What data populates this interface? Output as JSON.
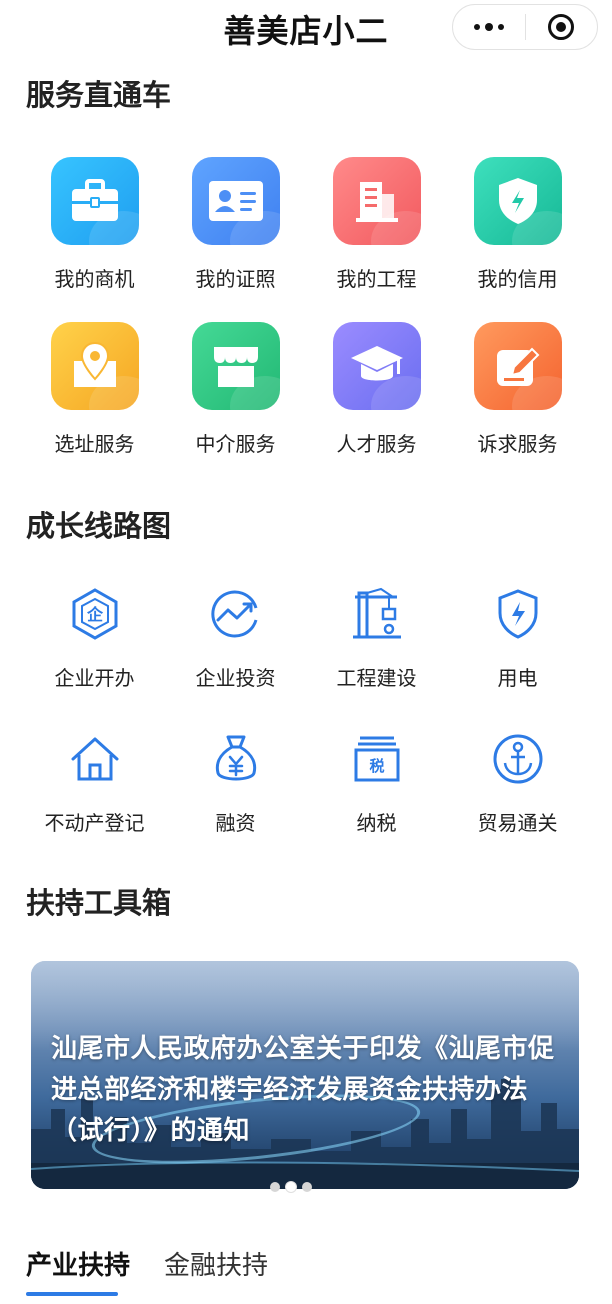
{
  "header": {
    "title": "善美店小二",
    "more_icon": "more-dots-icon",
    "close_icon": "target-circle-icon"
  },
  "service": {
    "title": "服务直通车",
    "items": [
      {
        "label": "我的商机",
        "icon": "briefcase-icon",
        "color": "#2fb0f5"
      },
      {
        "label": "我的证照",
        "icon": "id-card-icon",
        "color": "#4d8ff5"
      },
      {
        "label": "我的工程",
        "icon": "building-icon",
        "color": "#f56b6b"
      },
      {
        "label": "我的信用",
        "icon": "shield-icon",
        "color": "#21c9a8"
      },
      {
        "label": "选址服务",
        "icon": "map-pin-icon",
        "color": "#f9b733"
      },
      {
        "label": "中介服务",
        "icon": "store-icon",
        "color": "#2fcb86"
      },
      {
        "label": "人才服务",
        "icon": "graduation-cap-icon",
        "color": "#7a78f0"
      },
      {
        "label": "诉求服务",
        "icon": "edit-icon",
        "color": "#f7763f"
      }
    ]
  },
  "growth": {
    "title": "成长线路图",
    "items": [
      {
        "label": "企业开办",
        "icon": "enterprise-icon"
      },
      {
        "label": "企业投资",
        "icon": "trend-icon"
      },
      {
        "label": "工程建设",
        "icon": "crane-icon"
      },
      {
        "label": "用电",
        "icon": "electric-shield-icon"
      },
      {
        "label": "不动产登记",
        "icon": "house-icon"
      },
      {
        "label": "融资",
        "icon": "money-bag-icon"
      },
      {
        "label": "纳税",
        "icon": "tax-icon"
      },
      {
        "label": "贸易通关",
        "icon": "anchor-icon"
      }
    ],
    "accent": "#2d7be5",
    "tax_char": "税",
    "enterprise_char": "企"
  },
  "toolbox": {
    "title": "扶持工具箱",
    "banner_text": "汕尾市人民政府办公室关于印发《汕尾市促进总部经济和楼宇经济发展资金扶持办法（试行）》的通知"
  },
  "tabs": [
    {
      "label": "产业扶持",
      "active": true
    },
    {
      "label": "金融扶持",
      "active": false
    }
  ]
}
